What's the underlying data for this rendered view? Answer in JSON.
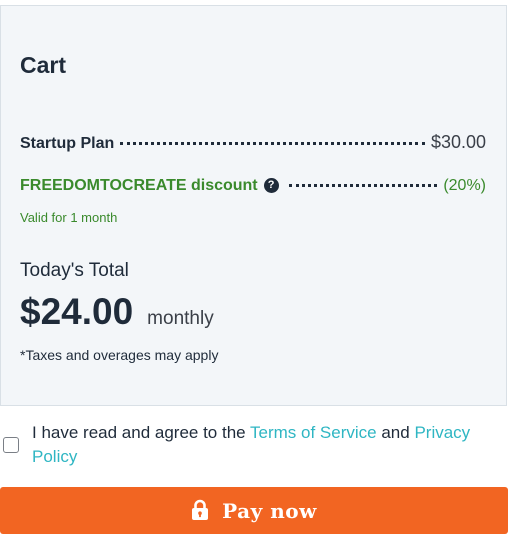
{
  "cart": {
    "title": "Cart",
    "plan_item": {
      "label": "Startup Plan",
      "price": "$30.00"
    },
    "discount_item": {
      "label": "FREEDOMTOCREATE discount",
      "value": "(20%)",
      "help_icon": "question-circle-icon"
    },
    "valid_note": "Valid for 1 month",
    "total_label": "Today's Total",
    "total_amount": "$24.00",
    "total_period": "monthly",
    "tax_note": "*Taxes and overages may apply"
  },
  "agreement": {
    "text_before": "I have read and agree to the ",
    "terms_link": "Terms of Service",
    "text_middle": " and ",
    "privacy_link": "Privacy Policy",
    "checked": false
  },
  "pay_button": {
    "label": "Pay now",
    "icon": "lock-icon"
  },
  "colors": {
    "accent": "#f26522",
    "link": "#2fb6c3",
    "discount": "#3a8a2c",
    "panel_bg": "#f3f6f9"
  }
}
